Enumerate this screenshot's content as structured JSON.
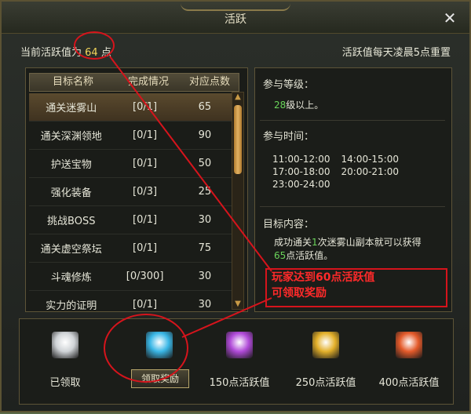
{
  "window": {
    "title": "活跃",
    "close_label": "✕"
  },
  "header": {
    "current_label_prefix": "当前活跃值为",
    "current_value": "64",
    "current_label_suffix": "点",
    "reset_text": "活跃值每天凌晨5点重置"
  },
  "table": {
    "columns": [
      "目标名称",
      "完成情况",
      "对应点数"
    ],
    "rows": [
      {
        "name": "通关迷雾山",
        "progress": "[0/1]",
        "points": "65"
      },
      {
        "name": "通关深渊领地",
        "progress": "[0/1]",
        "points": "90"
      },
      {
        "name": "护送宝物",
        "progress": "[0/1]",
        "points": "50"
      },
      {
        "name": "强化装备",
        "progress": "[0/3]",
        "points": "25"
      },
      {
        "name": "挑战BOSS",
        "progress": "[0/1]",
        "points": "30"
      },
      {
        "name": "通关虚空祭坛",
        "progress": "[0/1]",
        "points": "75"
      },
      {
        "name": "斗魂修炼",
        "progress": "[0/300]",
        "points": "30"
      },
      {
        "name": "实力的证明",
        "progress": "[0/1]",
        "points": "30"
      }
    ]
  },
  "details": {
    "level_label": "参与等级：",
    "level_value": "28",
    "level_suffix": "级以上。",
    "time_label": "参与时间：",
    "times": [
      [
        "11:00-12:00",
        "14:00-15:00"
      ],
      [
        "17:00-18:00",
        "20:00-21:00"
      ],
      [
        "23:00-24:00",
        ""
      ]
    ],
    "target_label": "目标内容：",
    "target_prefix": "成功通关",
    "target_count": "1",
    "target_mid": "次迷雾山副本就可以获得",
    "target_points": "65",
    "target_suffix": "点活跃值。"
  },
  "annotation": {
    "line1": "玩家达到60点活跃值",
    "line2": "可领取奖励"
  },
  "rewards": [
    {
      "label": "已领取",
      "chest_color": "#cfd3d6"
    },
    {
      "label": "领取奖励",
      "chest_color": "#3ab7e6"
    },
    {
      "label": "150点活跃值",
      "chest_color": "#b04ad8"
    },
    {
      "label": "250点活跃值",
      "chest_color": "#e3b02a"
    },
    {
      "label": "400点活跃值",
      "chest_color": "#e45a2a"
    }
  ],
  "colors": {
    "accent_red": "#d6141c",
    "value_yellow": "#f2d45a",
    "green": "#6ad45a"
  }
}
